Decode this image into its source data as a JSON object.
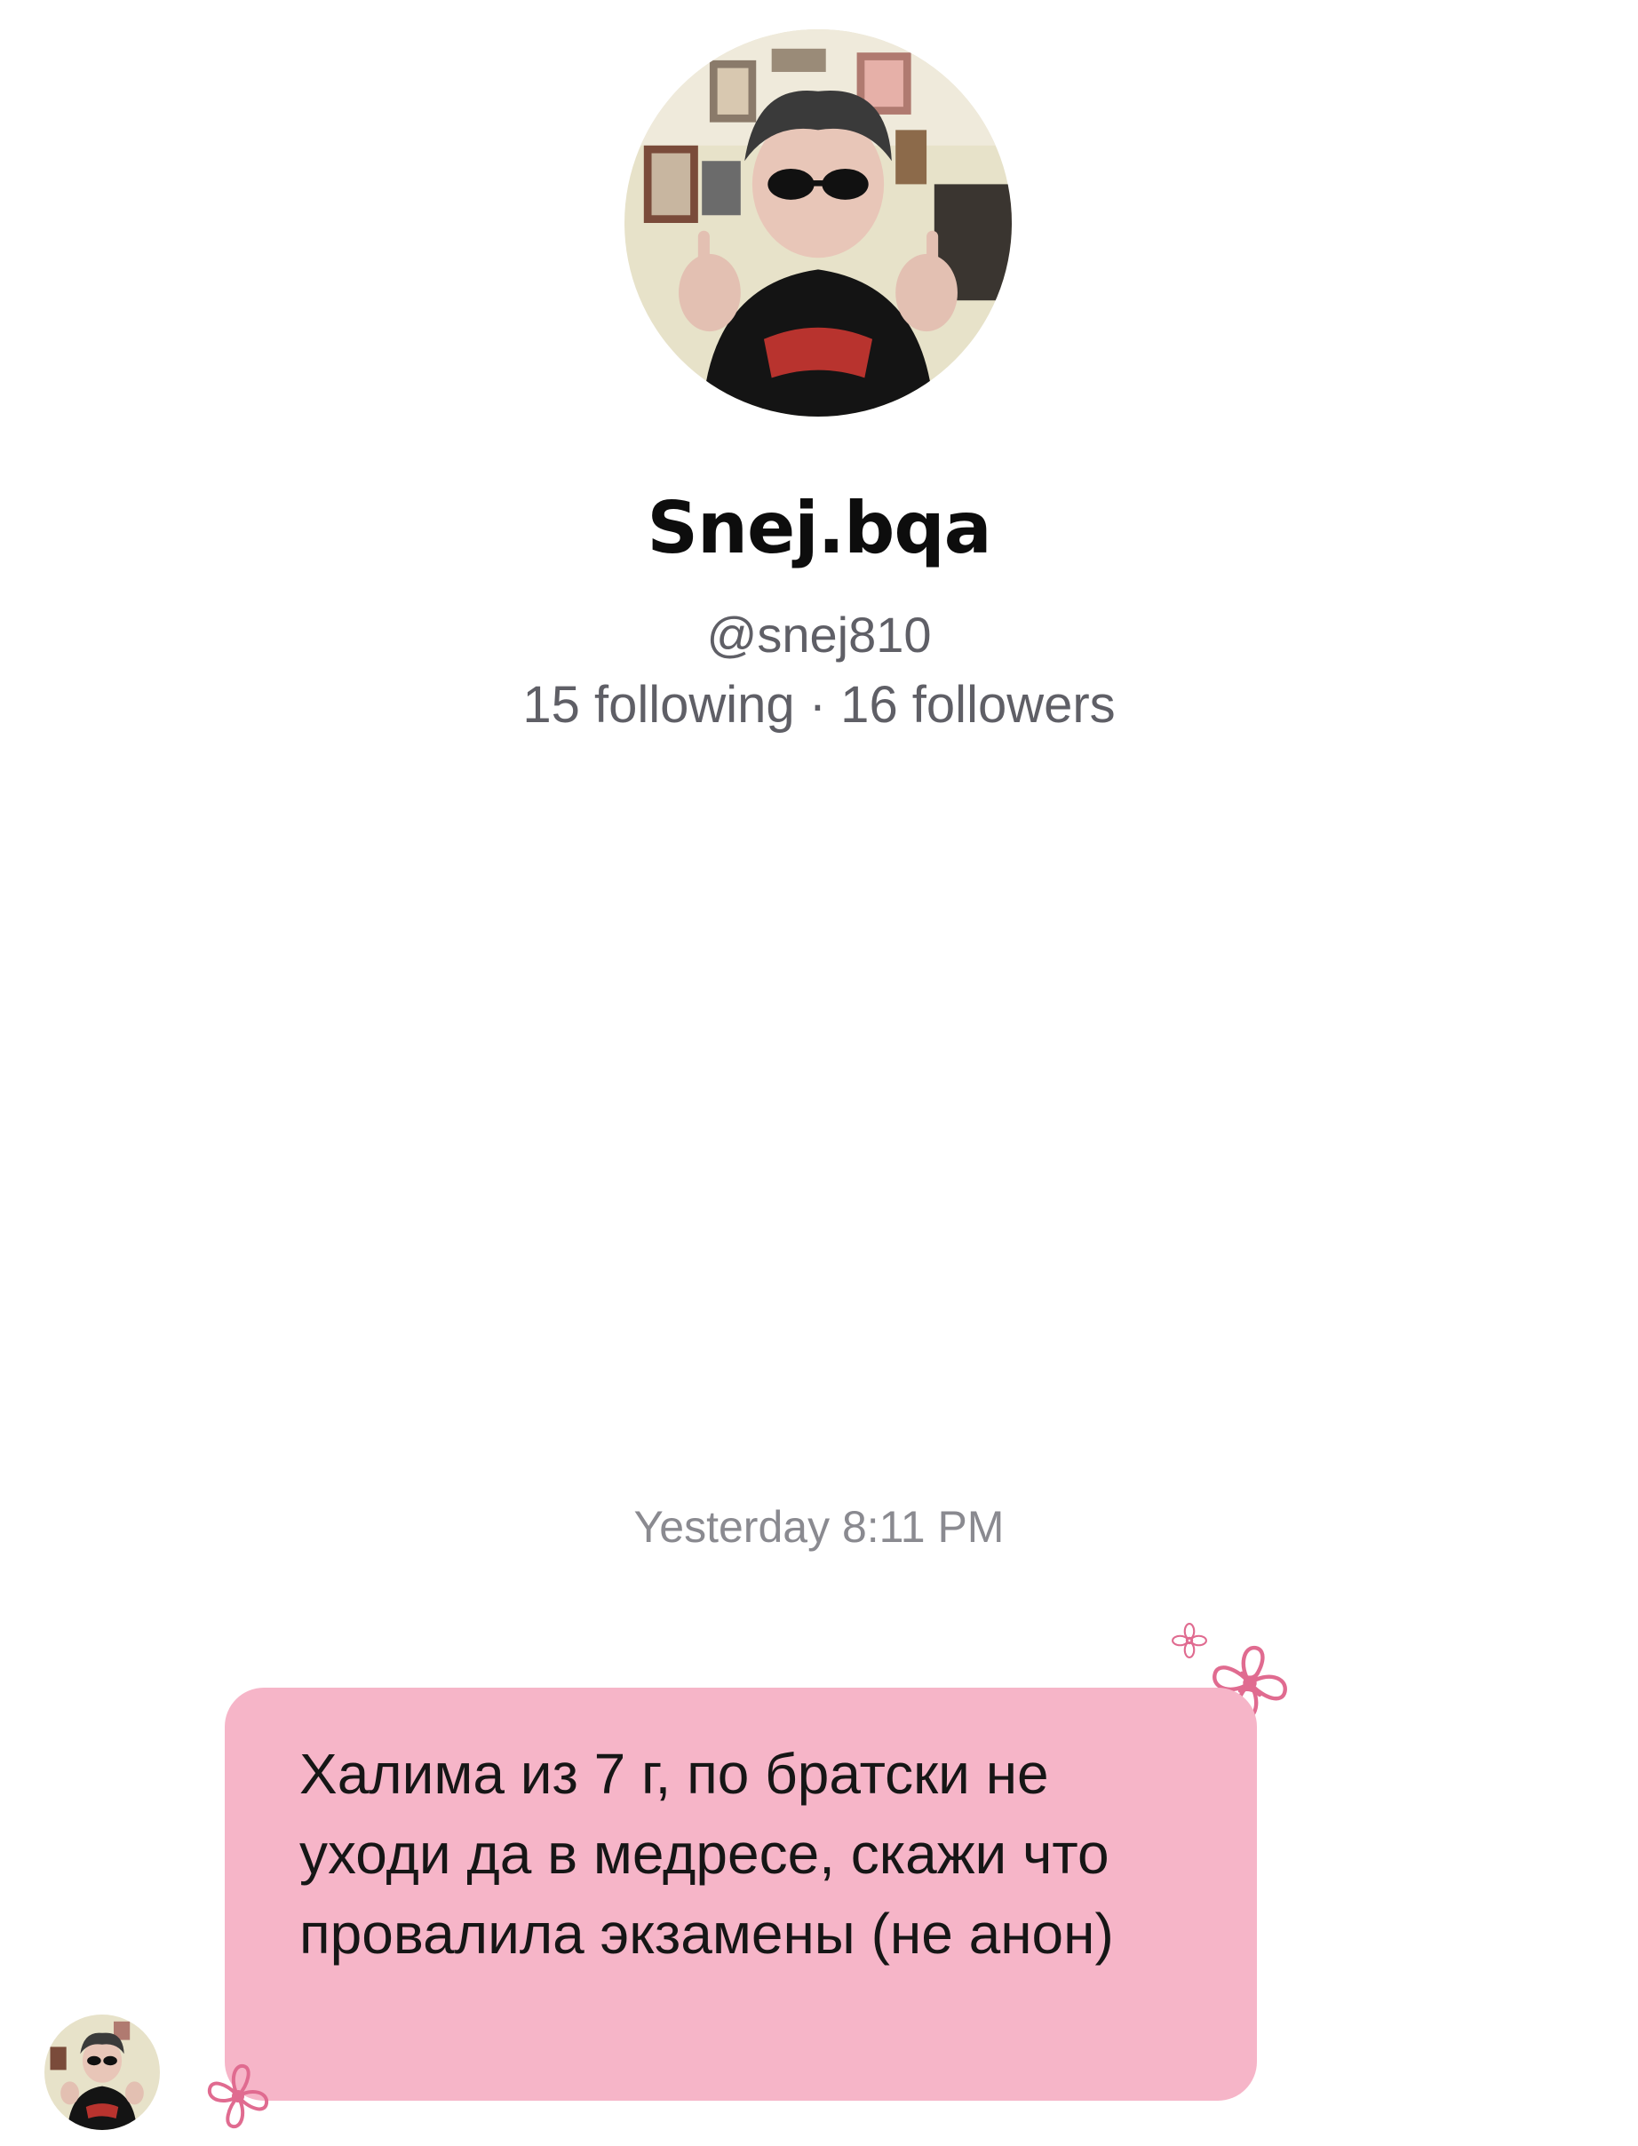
{
  "profile": {
    "display_name": "Snej.bqa",
    "handle": "@snej810",
    "stats": "15 following · 16 followers",
    "avatar_icon": "profile-photo"
  },
  "conversation": {
    "timestamp": "Yesterday 8:11 PM",
    "messages": [
      {
        "text": "Халима из 7 г, по братски не уходи да в медресе, скажи что провалила экзамены (не анон)"
      }
    ]
  },
  "colors": {
    "bubble": "#f6b5c8",
    "flower": "#e06b90",
    "muted_text": "#5f5f66",
    "timestamp_text": "#8a8a90"
  },
  "decorations": [
    "flower-doodle-icon",
    "small-flower-doodle-icon"
  ]
}
